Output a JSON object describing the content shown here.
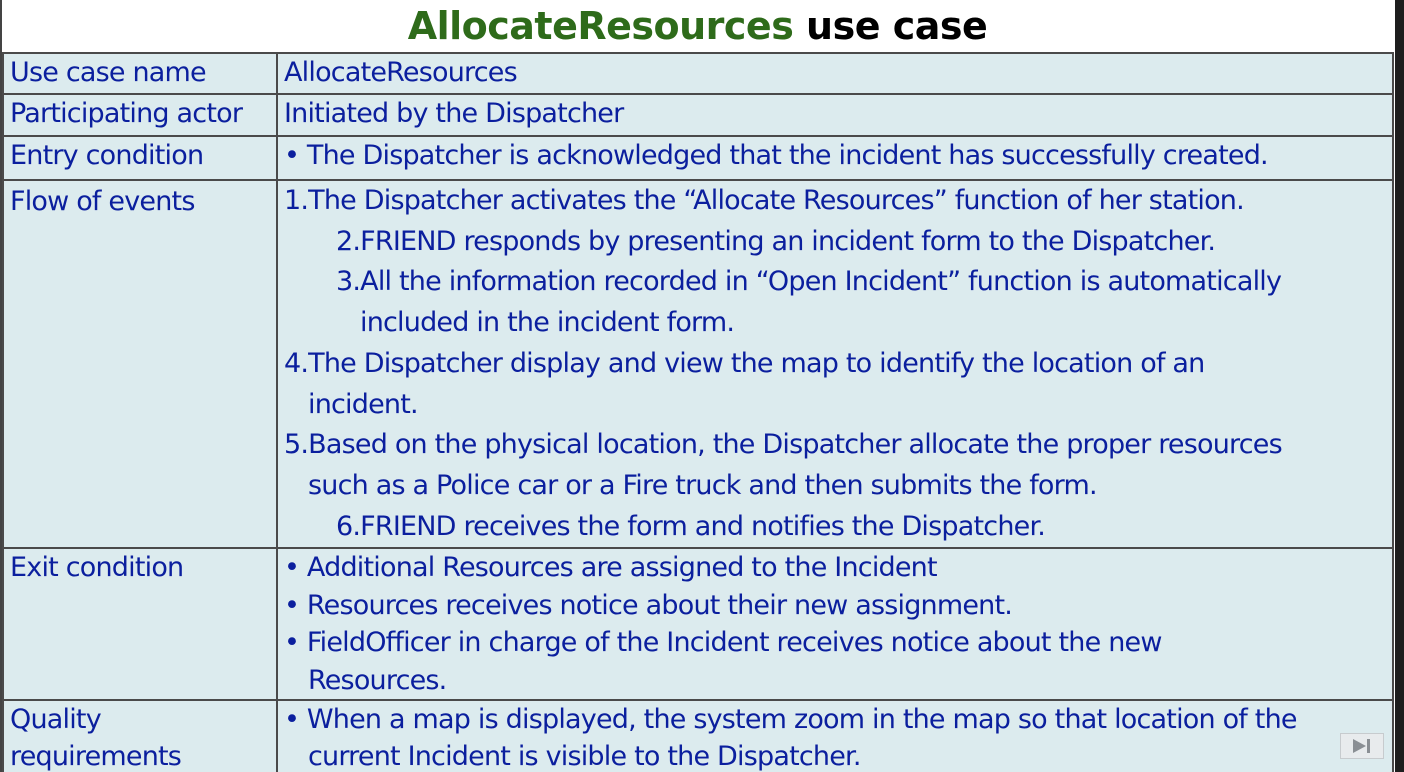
{
  "title": {
    "highlight": "AllocateResources",
    "rest": " use case"
  },
  "rows": {
    "name": {
      "label": "Use case name",
      "value": "AllocateResources"
    },
    "actor": {
      "label": "Participating actor",
      "value": "Initiated by the Dispatcher"
    },
    "entry": {
      "label": "Entry condition",
      "value": "• The Dispatcher is acknowledged that the incident has successfully created."
    },
    "flow": {
      "label": "Flow of events",
      "lines": [
        "1.The Dispatcher activates the “Allocate Resources” function of her station.",
        "2.FRIEND responds by presenting an incident form to the Dispatcher.",
        "3.All the information recorded in “Open Incident” function is automatically",
        "included in the incident form.",
        "4.The Dispatcher display and view the map to identify the location of an",
        "incident.",
        "5.Based on the physical location,  the Dispatcher allocate the proper resources",
        "such as a Police car or a Fire truck and then submits the form.",
        "6.FRIEND receives the form and notifies the Dispatcher."
      ]
    },
    "exit": {
      "label": "Exit condition",
      "lines": [
        "• Additional Resources are assigned to the Incident",
        "• Resources receives notice about their new assignment.",
        "• FieldOfficer in charge of the Incident receives notice about the new",
        "Resources."
      ]
    },
    "quality": {
      "label_lines": [
        "Quality",
        "requirements"
      ],
      "lines": [
        "• When a map is displayed, the system zoom in the map so that location of the",
        "current Incident is visible to the Dispatcher."
      ]
    }
  },
  "nav": {
    "icon": "play-next-icon"
  },
  "colors": {
    "title_green": "#2e6b1a",
    "text_blue": "#0b1f9e",
    "cell_bg": "#dcebee",
    "border": "#4a4a4a"
  }
}
